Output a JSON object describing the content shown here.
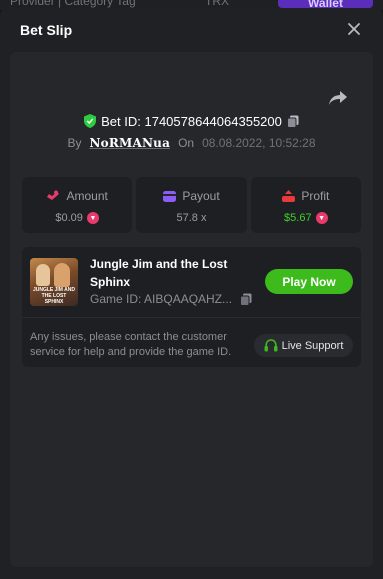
{
  "backdrop": {
    "breadcrumb": "Provider | Category Tag",
    "currency": "TRX",
    "wallet_label": "Wallet"
  },
  "modal": {
    "title": "Bet Slip"
  },
  "bet": {
    "id_label": "Bet ID: 1740578644064355200",
    "by_label": "By",
    "username": "NoRMANua",
    "on_label": "On",
    "timestamp": "08.08.2022, 10:52:28"
  },
  "stats": {
    "amount": {
      "label": "Amount",
      "value": "$0.09"
    },
    "payout": {
      "label": "Payout",
      "value": "57.8 x"
    },
    "profit": {
      "label": "Profit",
      "value": "$5.67"
    }
  },
  "game": {
    "thumbnail_text": "JUNGLE JIM AND THE LOST SPHINX",
    "title": "Jungle Jim and the Lost Sphinx",
    "game_id": "Game ID: AIBQAAQAHZ...",
    "play_label": "Play Now"
  },
  "support": {
    "text": "Any issues, please contact the customer service for help and provide the game ID.",
    "button_label": "Live Support"
  },
  "colors": {
    "accent_green": "#3dbb1d",
    "profit_green": "#3fd028",
    "amount_red": "#e83a6b",
    "payout_purple": "#8b5cf6",
    "shield_green": "#2ecc40"
  },
  "icons": {
    "close": "close-icon",
    "share": "share-icon",
    "shield": "shield-check-icon",
    "copy": "copy-icon",
    "amount": "coins-icon",
    "payout": "wallet-icon",
    "profit": "profit-icon",
    "currency": "trx-coin-icon",
    "support": "headset-icon"
  }
}
